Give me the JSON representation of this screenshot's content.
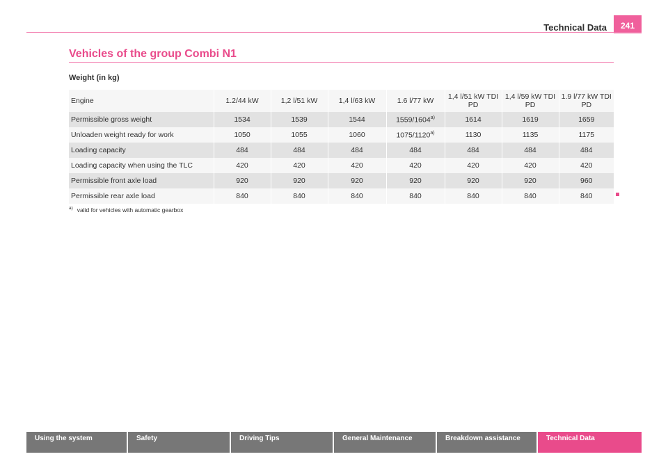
{
  "header": {
    "title": "Technical Data",
    "page_number": "241"
  },
  "section": {
    "title": "Vehicles of the group Combi N1",
    "subheading": "Weight (in kg)"
  },
  "table": {
    "columns": [
      "Engine",
      "1.2/44 kW",
      "1,2 l/51 kW",
      "1,4 l/63 kW",
      "1.6 l/77 kW",
      "1,4 l/51 kW TDI PD",
      "1,4 l/59 kW TDI PD",
      "1.9 l/77 kW TDI PD"
    ],
    "rows": [
      {
        "label": "Permissible gross weight",
        "values": [
          "1534",
          "1539",
          "1544",
          "1559/1604",
          "1614",
          "1619",
          "1659"
        ],
        "note_col": 3,
        "note": "a)"
      },
      {
        "label": "Unloaden weight ready for work",
        "values": [
          "1050",
          "1055",
          "1060",
          "1075/1120",
          "1130",
          "1135",
          "1175"
        ],
        "note_col": 3,
        "note": "a)"
      },
      {
        "label": "Loading capacity",
        "values": [
          "484",
          "484",
          "484",
          "484",
          "484",
          "484",
          "484"
        ]
      },
      {
        "label": "Loading capacity when using the TLC",
        "values": [
          "420",
          "420",
          "420",
          "420",
          "420",
          "420",
          "420"
        ]
      },
      {
        "label": "Permissible front axle load",
        "values": [
          "920",
          "920",
          "920",
          "920",
          "920",
          "920",
          "960"
        ]
      },
      {
        "label": "Permissible rear axle load",
        "values": [
          "840",
          "840",
          "840",
          "840",
          "840",
          "840",
          "840"
        ]
      }
    ]
  },
  "footnote": {
    "marker": "a)",
    "text": "valid for vehicles with automatic gearbox"
  },
  "nav": {
    "tabs": [
      {
        "label": "Using the system",
        "active": false
      },
      {
        "label": "Safety",
        "active": false
      },
      {
        "label": "Driving Tips",
        "active": false
      },
      {
        "label": "General Maintenance",
        "active": false
      },
      {
        "label": "Breakdown assistance",
        "active": false
      },
      {
        "label": "Technical Data",
        "active": true
      }
    ]
  },
  "colors": {
    "accent": "#e94b8b",
    "nav_inactive": "#777777",
    "row_shade": "#e2e2e2",
    "row_plain": "#f6f6f6"
  }
}
